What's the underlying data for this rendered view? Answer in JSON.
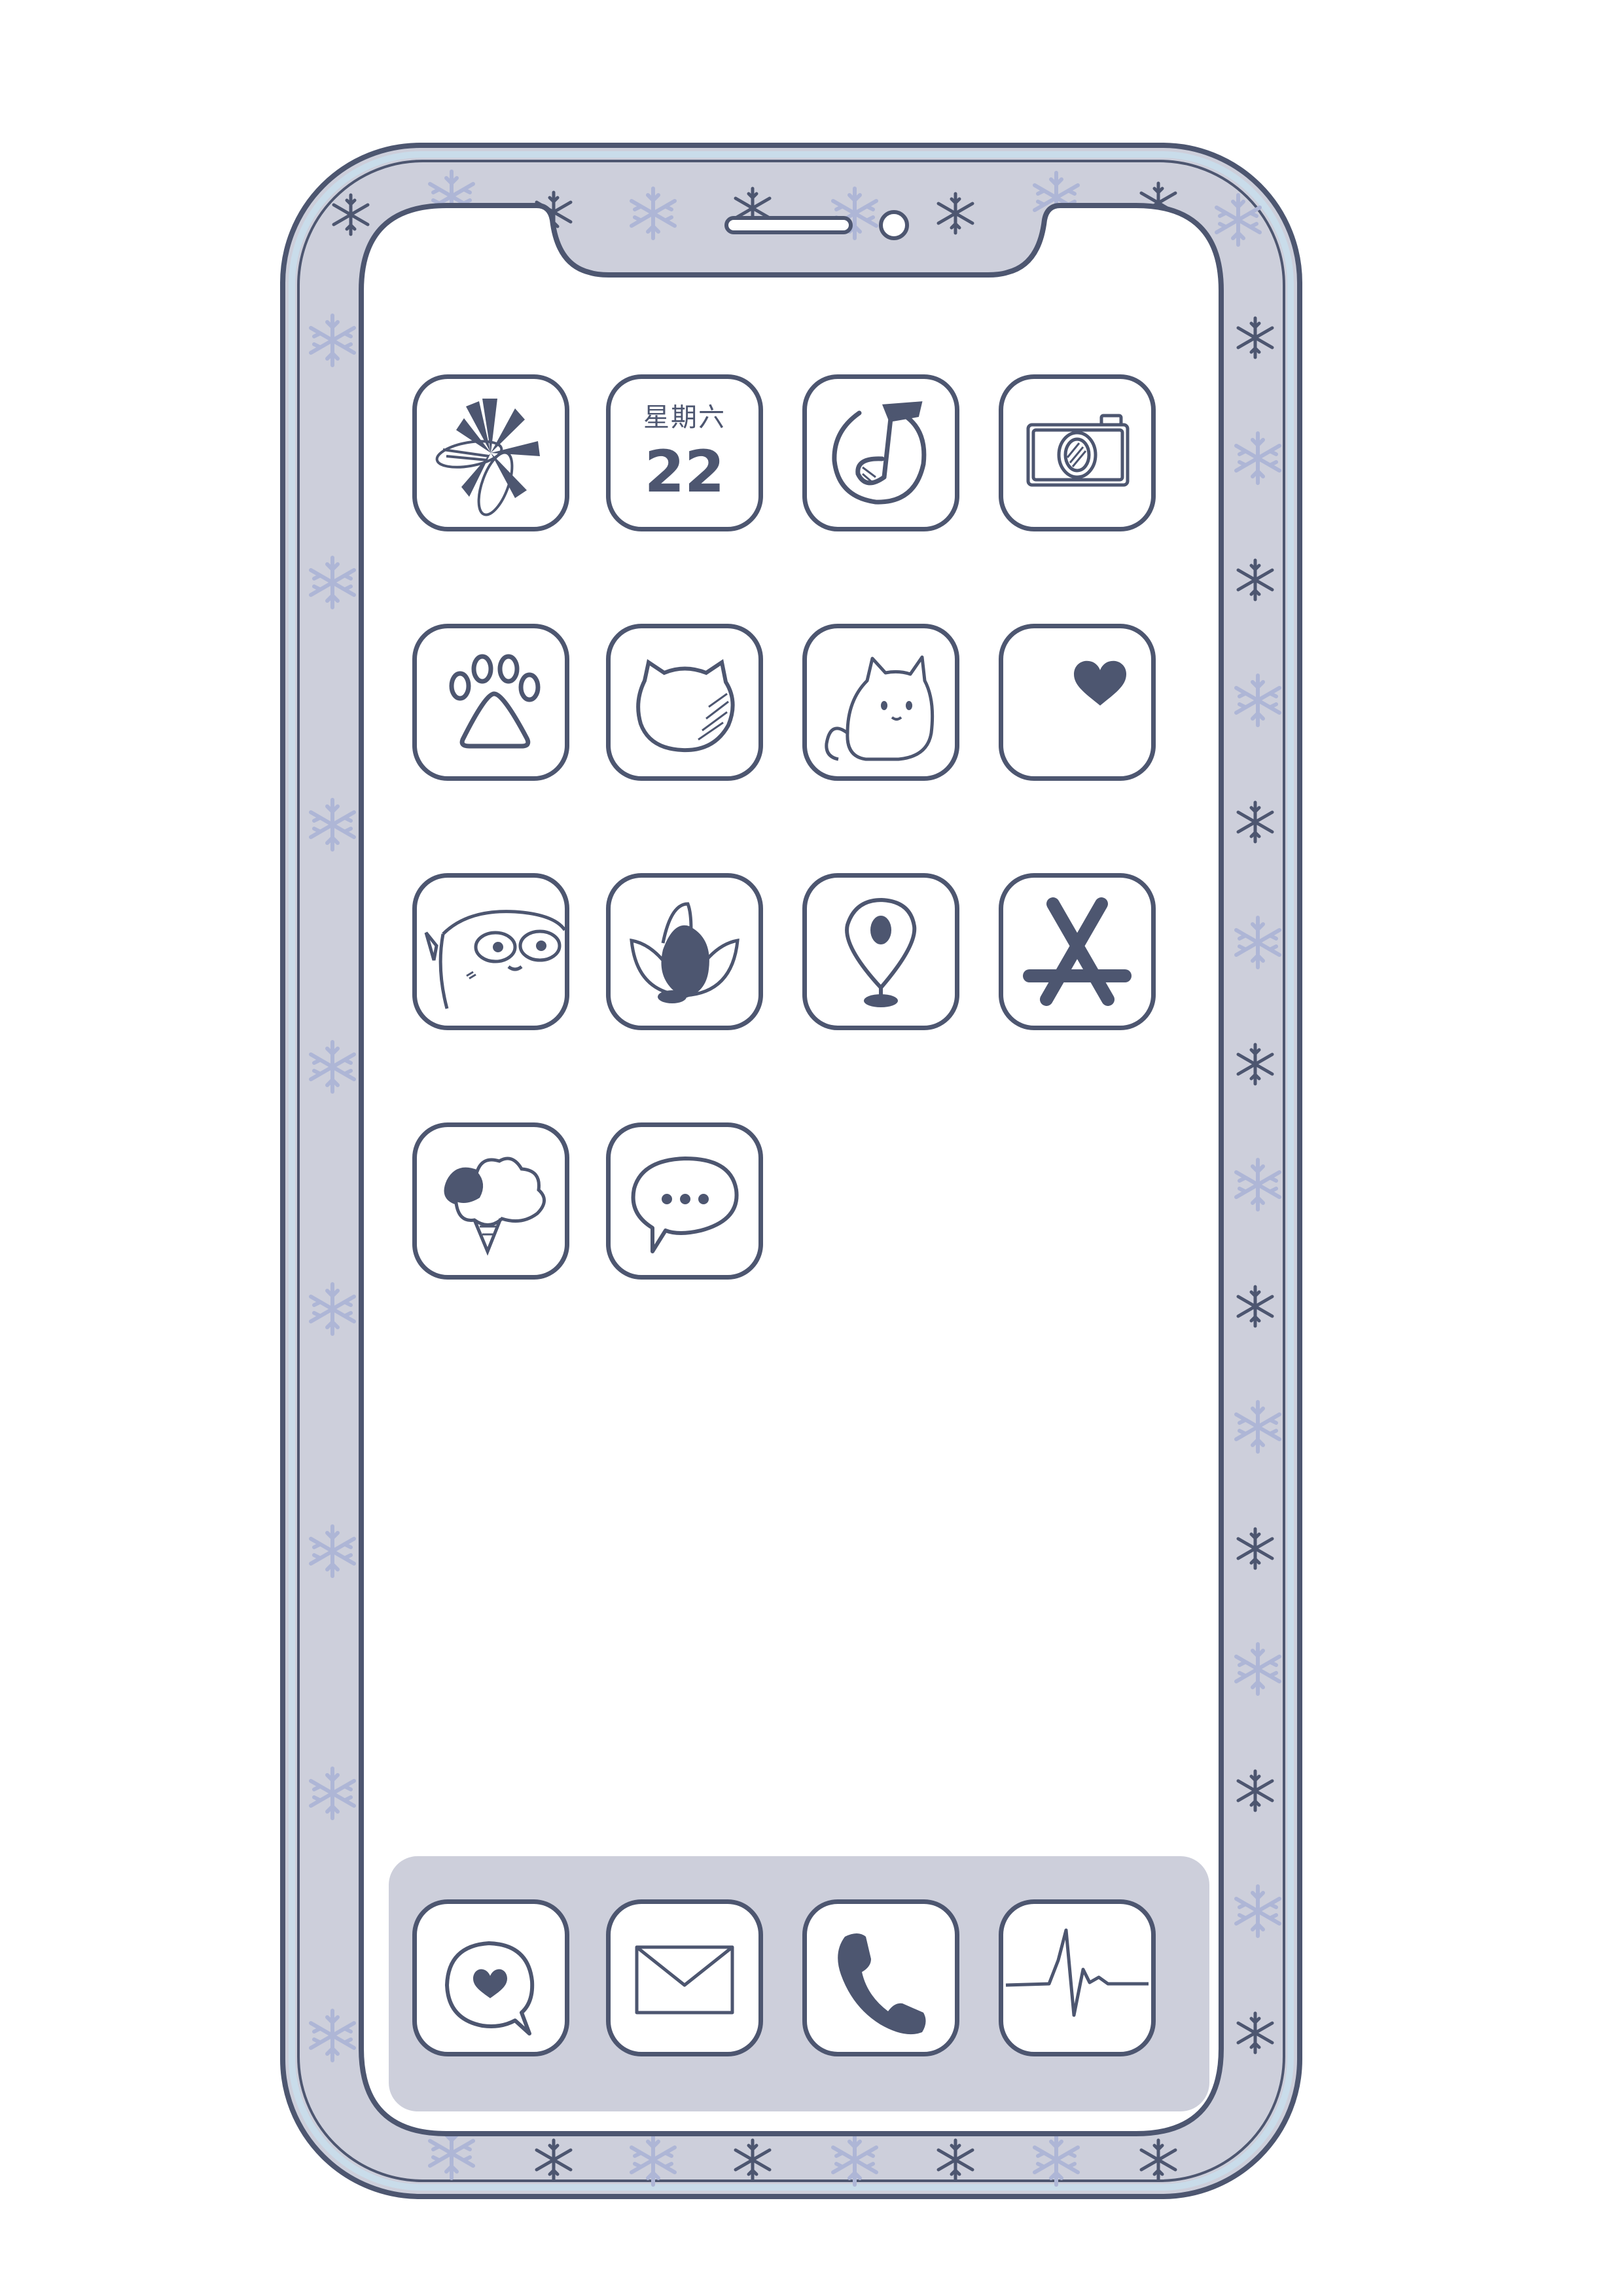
{
  "theme": {
    "ink": "#4d5670",
    "frame_fill": "#cdcfdb",
    "frame_edge": "#c9dcea",
    "snowflake": "#aeb6d6",
    "dock_fill": "#cdcfdb",
    "screen": "#ffffff"
  },
  "home_screen": {
    "apps": [
      {
        "icon": "flower-icon"
      },
      {
        "icon": "calendar-icon",
        "weekday": "星期六",
        "day": "22"
      },
      {
        "icon": "music-note-icon"
      },
      {
        "icon": "camera-icon"
      },
      {
        "icon": "paw-icon"
      },
      {
        "icon": "cat-face-icon"
      },
      {
        "icon": "cat-mascot-icon"
      },
      {
        "icon": "heart-icon"
      },
      {
        "icon": "cartoon-face-icon"
      },
      {
        "icon": "lotus-icon"
      },
      {
        "icon": "map-pin-icon"
      },
      {
        "icon": "app-store-icon"
      },
      {
        "icon": "ice-cream-icon"
      },
      {
        "icon": "chat-bubble-icon"
      }
    ]
  },
  "dock": {
    "apps": [
      {
        "icon": "heart-chat-icon"
      },
      {
        "icon": "mail-icon"
      },
      {
        "icon": "phone-icon"
      },
      {
        "icon": "heartbeat-icon"
      }
    ]
  },
  "decorations": {
    "pattern": "snowflake-icon"
  }
}
